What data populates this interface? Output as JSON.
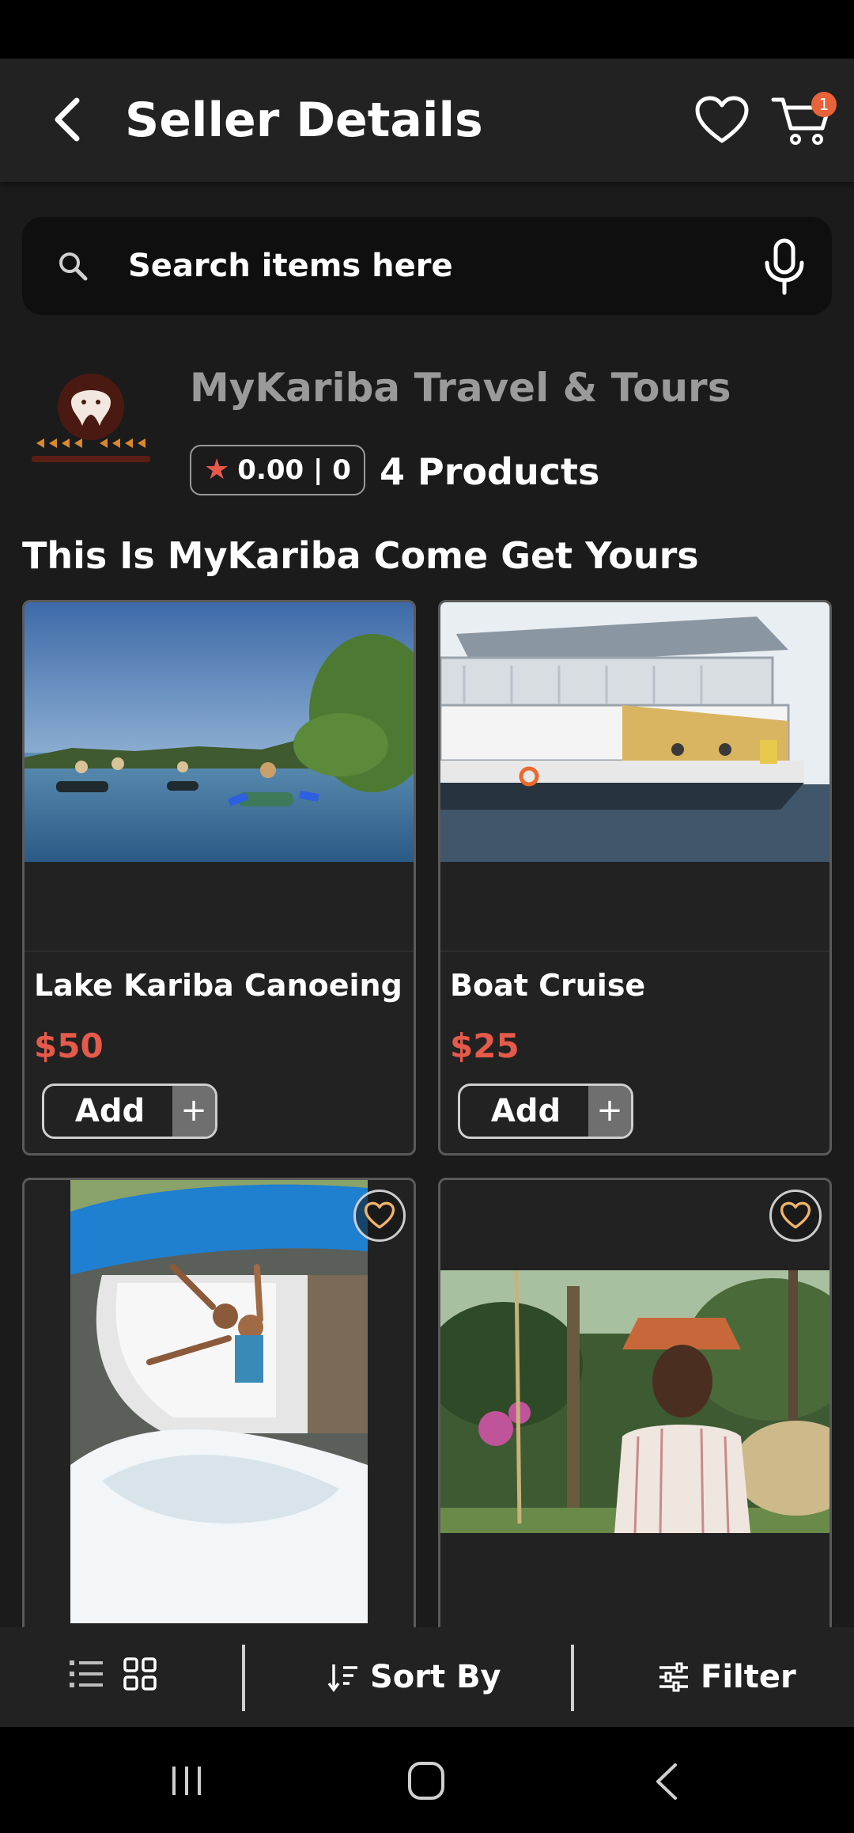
{
  "header": {
    "title": "Seller Details",
    "cart_count": "1"
  },
  "search": {
    "placeholder": "Search items here"
  },
  "seller": {
    "name": "MyKariba Travel & Tours",
    "rating": "0.00 | 0",
    "products": "4 Products",
    "tagline": "This Is MyKariba Come Get Yours"
  },
  "products": [
    {
      "title": "Lake Kariba Canoeing",
      "price": "$50",
      "add_label": "Add",
      "add_icon": "+"
    },
    {
      "title": "Boat Cruise",
      "price": "$25",
      "add_label": "Add",
      "add_icon": "+"
    }
  ],
  "bottom_bar": {
    "sort_label": "Sort By",
    "filter_label": "Filter"
  },
  "colors": {
    "accent": "#e55a4a",
    "badge": "#e8623a",
    "background": "#1b1b1b",
    "panel": "#222222"
  },
  "icons": [
    "back-arrow-icon",
    "heart-icon",
    "cart-icon",
    "search-icon",
    "mic-icon",
    "star-icon",
    "plus-icon",
    "list-view-icon",
    "grid-view-icon",
    "sort-icon",
    "filter-icon",
    "recent-apps-icon",
    "home-icon",
    "nav-back-icon"
  ]
}
